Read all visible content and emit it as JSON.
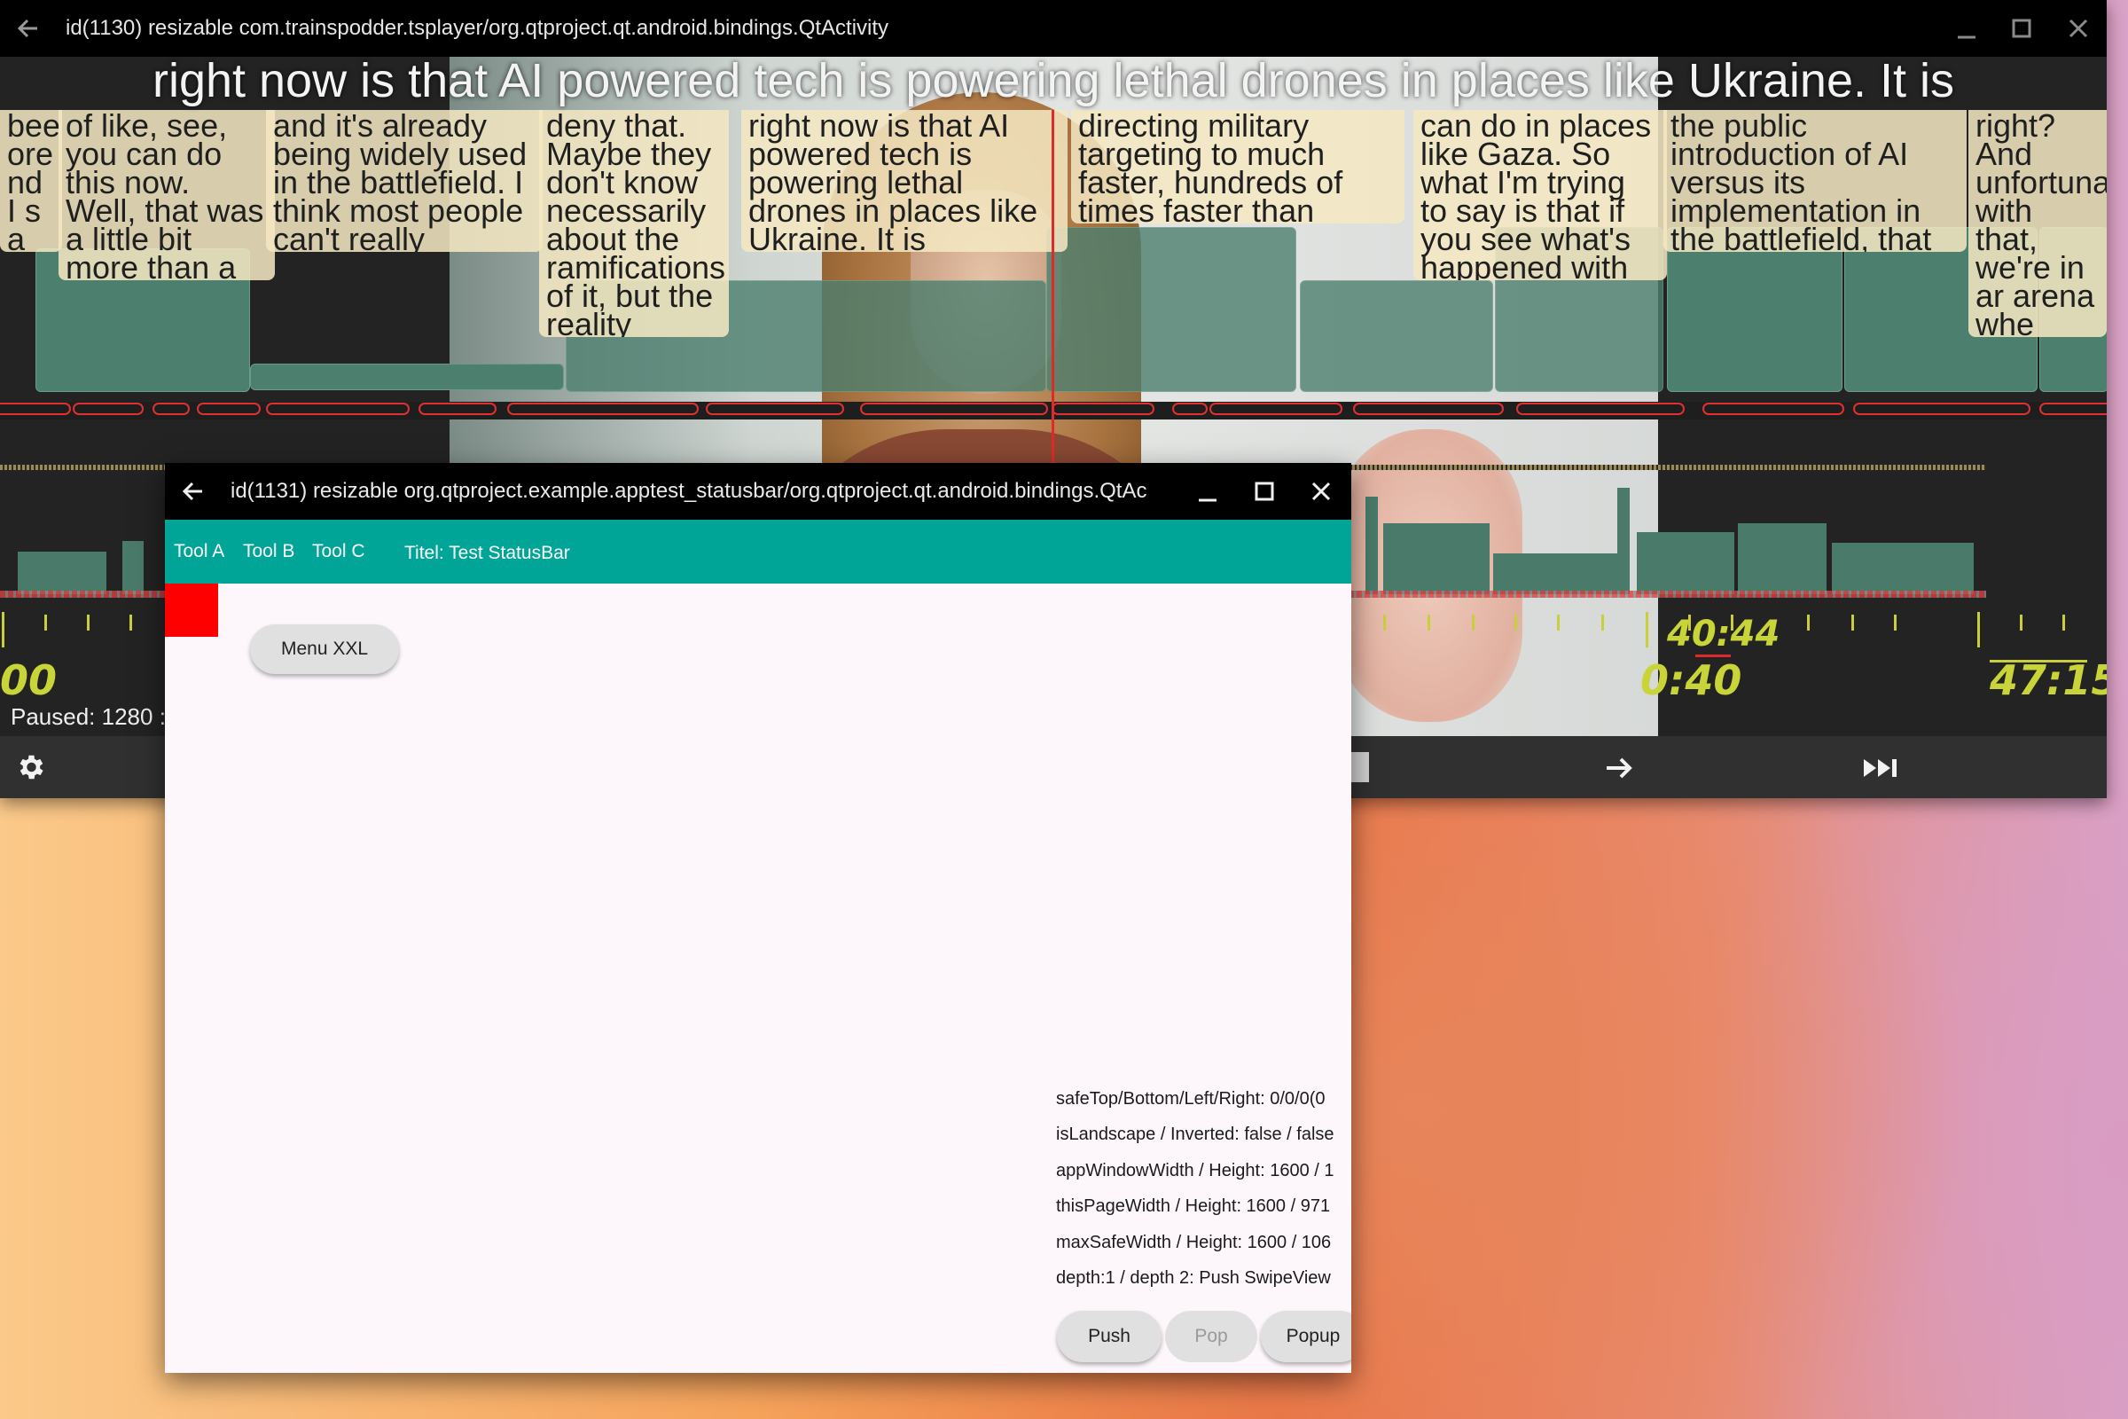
{
  "player_window": {
    "title": "id(1130) resizable com.trainspodder.tsplayer/org.qtproject.qt.android.bindings.QtActivity",
    "subtitle": "right now is that AI powered tech is powering lethal drones in places like Ukraine. It is",
    "captions": [
      "been ore nd I s a",
      "of like, see, you can do this now. Well, that was a little bit more than a year ago,",
      "and it's already being widely used in the battlefield. I think most people can't really",
      "deny that. Maybe they don't know necessarily about the ramifications of it, but the reality",
      "right now is that AI powered tech is powering lethal drones in places like Ukraine. It is",
      "directing military targeting to much faster, hundreds of times faster than human intelligence",
      "can do in places like Gaza. So what I'm trying to say is that if you see what's happened with",
      "the public introduction of AI versus its implementation in the battlefield, that was very fast,",
      "right? And unfortuna with that, we're in ar arena whe there's be little publi debate"
    ],
    "time_marker": "40:44",
    "time_left_partial": "00",
    "time_current": "0:40",
    "time_total": "47:15",
    "status": "Paused: 1280 :",
    "icons": [
      "back-arrow-icon",
      "minimize-icon",
      "maximize-icon",
      "close-icon",
      "gear-icon",
      "arrow-right-icon",
      "skip-to-end-icon"
    ]
  },
  "statusbar_window": {
    "title": "id(1131) resizable org.qtproject.example.apptest_statusbar/org.qtproject.qt.android.bindings.QtAc",
    "toolbar": {
      "tools": [
        "Tool A",
        "Tool B",
        "Tool C"
      ],
      "titel": "Titel: Test StatusBar"
    },
    "menu_button": "Menu XXL",
    "info_lines": [
      "safeTop/Bottom/Left/Right: 0/0/0(0",
      "isLandscape / Inverted: false / false",
      "appWindowWidth / Height: 1600 / 1",
      " thisPageWidth / Height: 1600 / 971",
      "maxSafeWidth / Height: 1600 / 106",
      "depth:1 / depth 2: Push SwipeView"
    ],
    "buttons": {
      "push": "Push",
      "pop": "Pop",
      "popup": "Popup"
    },
    "accent_color": "#00a598",
    "indicator_color": "#ff0000"
  }
}
